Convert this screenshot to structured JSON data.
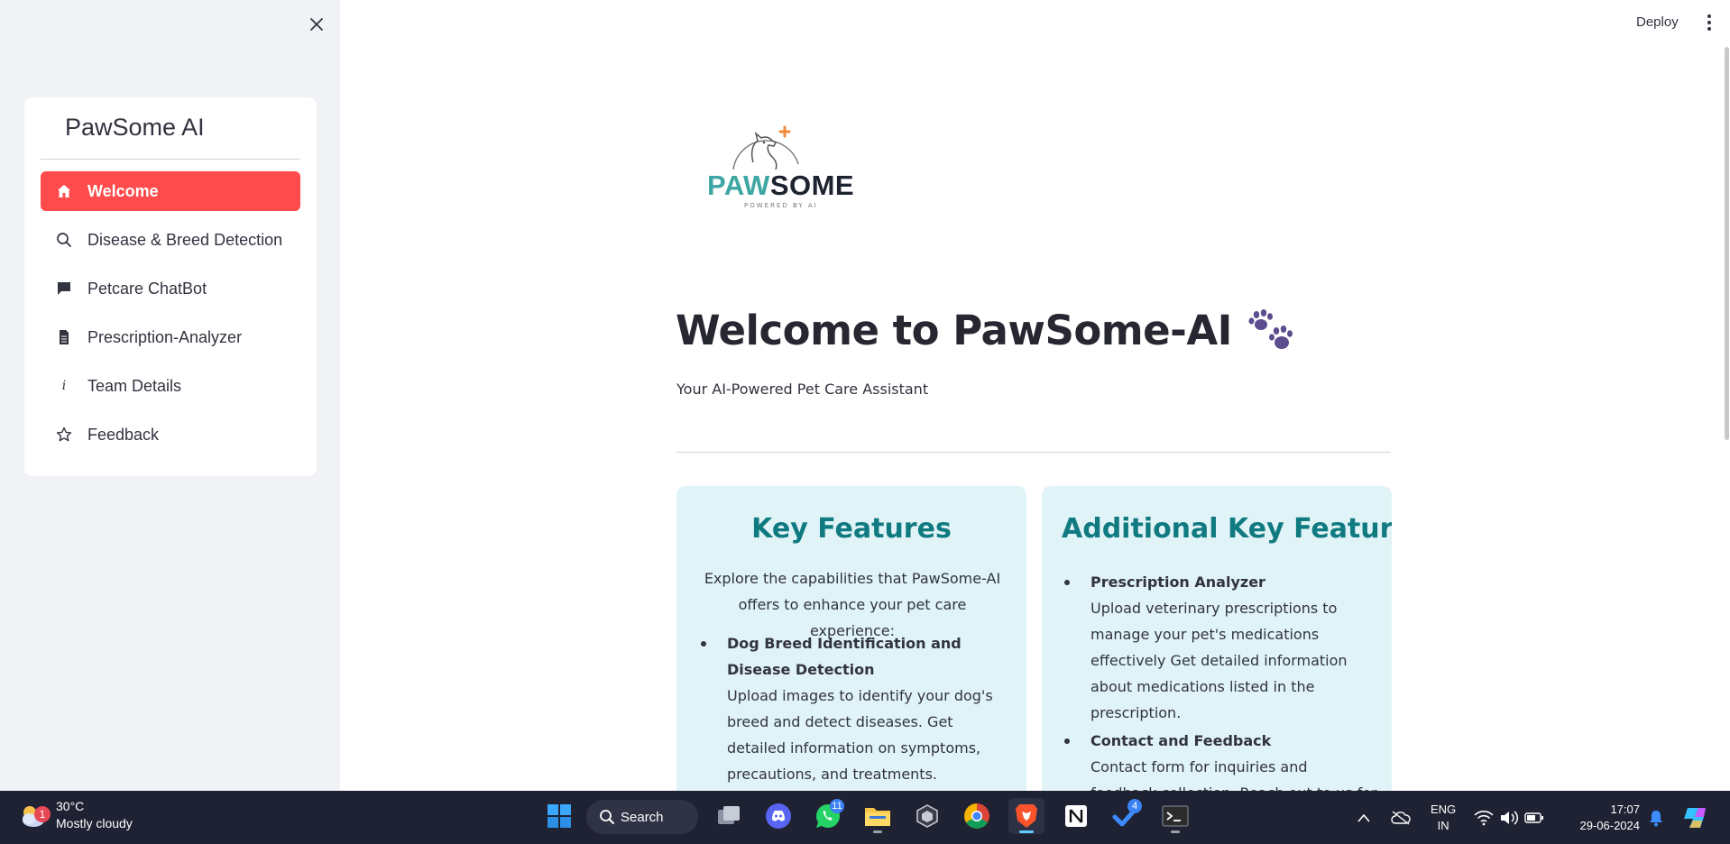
{
  "sidebar": {
    "title": "PawSome AI",
    "items": [
      {
        "label": "Welcome",
        "icon": "home-icon",
        "active": true
      },
      {
        "label": "Disease & Breed Detection",
        "icon": "search-icon"
      },
      {
        "label": "Petcare ChatBot",
        "icon": "chat-icon"
      },
      {
        "label": "Prescription-Analyzer",
        "icon": "document-icon"
      },
      {
        "label": "Team Details",
        "icon": "info-icon"
      },
      {
        "label": "Feedback",
        "icon": "star-icon"
      }
    ]
  },
  "header": {
    "deploy_label": "Deploy"
  },
  "main": {
    "logo": {
      "paw": "PAW",
      "some": "SOME",
      "tagline": "POWERED BY AI"
    },
    "title": "Welcome to PawSome-AI",
    "subtitle": "Your AI-Powered Pet Care Assistant",
    "card1": {
      "heading": "Key Features",
      "intro": "Explore the capabilities that PawSome-AI offers to enhance your pet care experience:",
      "features": [
        {
          "title": "Dog Breed Identification and Disease Detection",
          "desc": "Upload images to identify your dog's breed and detect diseases. Get detailed information on symptoms, precautions, and treatments."
        }
      ]
    },
    "card2": {
      "heading": "Additional Key Features",
      "features": [
        {
          "title": "Prescription Analyzer",
          "desc": "Upload veterinary prescriptions to manage your pet's medications effectively Get detailed information about medications listed in the prescription."
        },
        {
          "title": "Contact and Feedback",
          "desc": "Contact form for inquiries and feedback collection. Reach out to us for any"
        }
      ]
    }
  },
  "taskbar": {
    "weather": {
      "temp": "30°C",
      "condition": "Mostly cloudy",
      "badge": "1"
    },
    "search_label": "Search",
    "apps": [
      {
        "name": "windows-start"
      },
      {
        "name": "task-view"
      },
      {
        "name": "discord"
      },
      {
        "name": "whatsapp",
        "badge": "11"
      },
      {
        "name": "file-explorer"
      },
      {
        "name": "unity"
      },
      {
        "name": "chrome"
      },
      {
        "name": "brave"
      },
      {
        "name": "notion"
      },
      {
        "name": "tasks",
        "badge": "4"
      },
      {
        "name": "terminal"
      }
    ],
    "language": {
      "line1": "ENG",
      "line2": "IN"
    },
    "clock": {
      "time": "17:07",
      "date": "29-06-2024"
    }
  },
  "colors": {
    "accent": "#ff4b4b",
    "sidebar_bg": "#f0f2f6",
    "card_bg": "#e0f3f7",
    "card_heading": "#0f7a80",
    "taskbar_bg": "#1f2233"
  }
}
